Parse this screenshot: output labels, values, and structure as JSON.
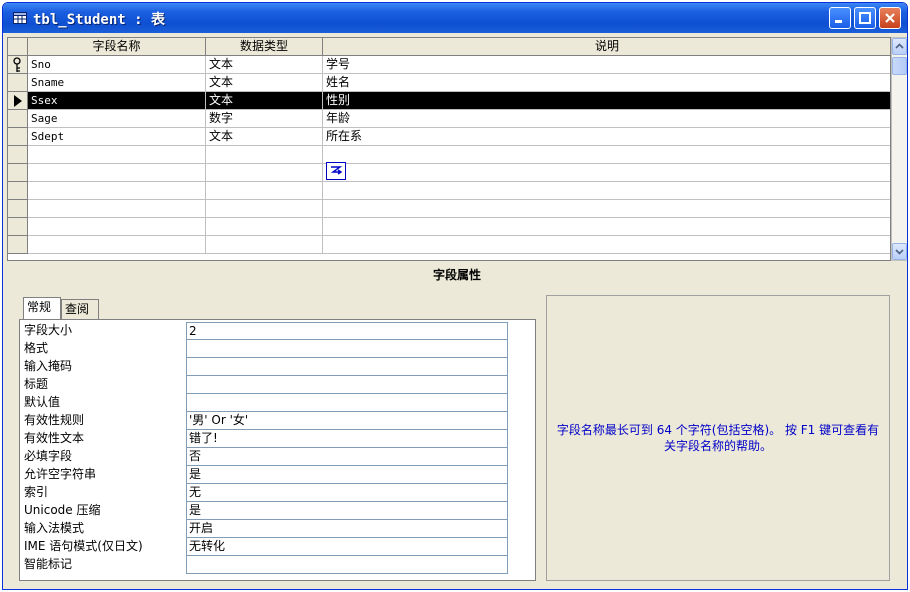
{
  "window": {
    "title": "tbl_Student : 表"
  },
  "grid": {
    "headers": [
      "字段名称",
      "数据类型",
      "说明"
    ],
    "rows": [
      {
        "name": "Sno",
        "type": "文本",
        "desc": "学号"
      },
      {
        "name": "Sname",
        "type": "文本",
        "desc": "姓名"
      },
      {
        "name": "Ssex",
        "type": "文本",
        "desc": "性别"
      },
      {
        "name": "Sage",
        "type": "数字",
        "desc": "年龄"
      },
      {
        "name": "Sdept",
        "type": "文本",
        "desc": "所在系"
      },
      {
        "name": "",
        "type": "",
        "desc": ""
      },
      {
        "name": "",
        "type": "",
        "desc": ""
      },
      {
        "name": "",
        "type": "",
        "desc": ""
      },
      {
        "name": "",
        "type": "",
        "desc": ""
      },
      {
        "name": "",
        "type": "",
        "desc": ""
      },
      {
        "name": "",
        "type": "",
        "desc": ""
      }
    ],
    "primary_key_row": 0,
    "selected_row": 2
  },
  "properties": {
    "section_title": "字段属性",
    "tabs": [
      "常规",
      "查阅"
    ],
    "active_tab": 0,
    "items": [
      {
        "label": "字段大小",
        "value": "2"
      },
      {
        "label": "格式",
        "value": ""
      },
      {
        "label": "输入掩码",
        "value": ""
      },
      {
        "label": "标题",
        "value": ""
      },
      {
        "label": "默认值",
        "value": ""
      },
      {
        "label": "有效性规则",
        "value": "'男' Or '女'"
      },
      {
        "label": "有效性文本",
        "value": "错了!"
      },
      {
        "label": "必填字段",
        "value": "否"
      },
      {
        "label": "允许空字符串",
        "value": "是"
      },
      {
        "label": "索引",
        "value": "无"
      },
      {
        "label": "Unicode 压缩",
        "value": "是"
      },
      {
        "label": "输入法模式",
        "value": "开启"
      },
      {
        "label": "IME 语句模式(仅日文)",
        "value": "无转化"
      },
      {
        "label": "智能标记",
        "value": ""
      }
    ]
  },
  "help": {
    "text": "字段名称最长可到 64 个字符(包括空格)。 按 F1 键可查看有关字段名称的帮助。"
  },
  "colors": {
    "titlebar": "#0f4fd2",
    "selection": "#000000",
    "help_text": "#0000c8",
    "window_bg": "#ece9d8"
  }
}
